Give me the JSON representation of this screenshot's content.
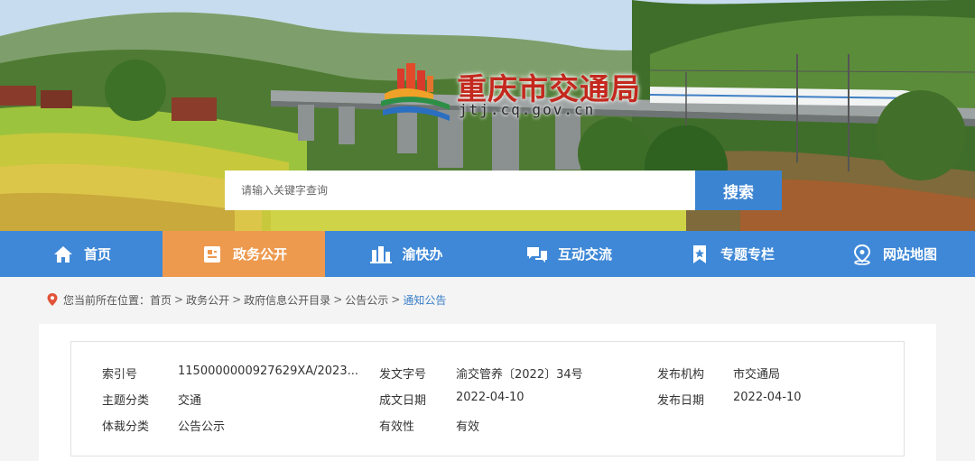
{
  "header": {
    "title": "重庆市交通局",
    "domain": "jtj.cq.gov.cn"
  },
  "search": {
    "placeholder": "请输入关键字查询",
    "button_label": "搜索"
  },
  "nav": {
    "items": [
      {
        "label": "首页",
        "icon": "home-icon"
      },
      {
        "label": "政务公开",
        "icon": "document-icon",
        "active": true
      },
      {
        "label": "渝快办",
        "icon": "building-icon"
      },
      {
        "label": "互动交流",
        "icon": "chat-icon"
      },
      {
        "label": "专题专栏",
        "icon": "bookmark-star-icon"
      },
      {
        "label": "网站地图",
        "icon": "map-pin-icon"
      }
    ],
    "colors": {
      "bar": "#3f88d7",
      "active": "#ed9a4f"
    }
  },
  "breadcrumb": {
    "prefix": "您当前所在位置：",
    "items": [
      "首页",
      "政务公开",
      "政府信息公开目录",
      "公告公示"
    ],
    "current": "通知公告",
    "separator": ">"
  },
  "info": {
    "index_label": "索引号",
    "index_value": "1150000000927629XA/2023...",
    "doc_no_label": "发文字号",
    "doc_no_value": "渝交管养〔2022〕34号",
    "publisher_label": "发布机构",
    "publisher_value": "市交通局",
    "topic_label": "主题分类",
    "topic_value": "交通",
    "created_label": "成文日期",
    "created_value": "2022-04-10",
    "published_label": "发布日期",
    "published_value": "2022-04-10",
    "genre_label": "体裁分类",
    "genre_value": "公告公示",
    "validity_label": "有效性",
    "validity_value": "有效"
  }
}
